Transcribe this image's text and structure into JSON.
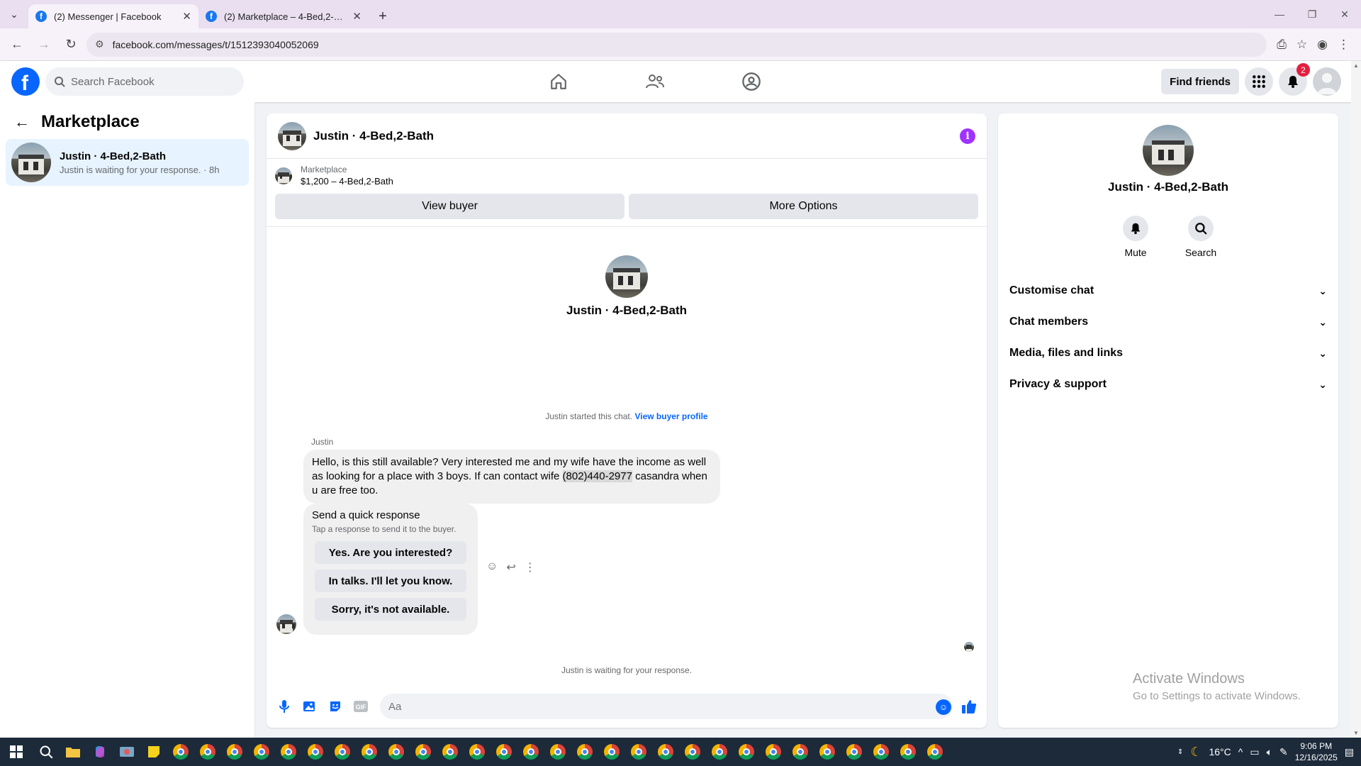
{
  "browser": {
    "tabs": [
      {
        "title": "(2) Messenger | Facebook",
        "active": true
      },
      {
        "title": "(2) Marketplace – 4-Bed,2-Bath",
        "active": false
      }
    ],
    "url": "facebook.com/messages/t/1512393040052069"
  },
  "fb_nav": {
    "search_placeholder": "Search Facebook",
    "find_friends": "Find friends",
    "notification_count": "2"
  },
  "left_panel": {
    "title": "Marketplace",
    "conversation": {
      "name": "Justin · 4-Bed,2-Bath",
      "preview": "Justin is waiting for your response. · 8h"
    }
  },
  "chat": {
    "title": "Justin · 4-Bed,2-Bath",
    "marketplace_label": "Marketplace",
    "listing": "$1,200 – 4-Bed,2-Bath",
    "view_buyer": "View buyer",
    "more_options": "More Options",
    "intro_name": "Justin · 4-Bed,2-Bath",
    "started_text": "Justin started this chat.",
    "view_buyer_profile": "View buyer profile",
    "sender": "Justin",
    "message_before_phone": "Hello, is this still available? Very interested me and my wife have the income as well as looking for a place with 3 boys. If can contact wife ",
    "message_phone": "(802)440-2977",
    "message_after_phone": " casandra when u are free too.",
    "quick_response_title": "Send a quick response",
    "quick_response_sub": "Tap a response to send it to the buyer.",
    "quick_responses": [
      "Yes. Are you interested?",
      "In talks. I'll let you know.",
      "Sorry, it's not available."
    ],
    "waiting": "Justin is waiting for your response.",
    "composer_placeholder": "Aa"
  },
  "right_panel": {
    "name": "Justin · 4-Bed,2-Bath",
    "mute": "Mute",
    "search": "Search",
    "sections": [
      "Customise chat",
      "Chat members",
      "Media, files and links",
      "Privacy & support"
    ],
    "activate_title": "Activate Windows",
    "activate_sub": "Go to Settings to activate Windows."
  },
  "taskbar": {
    "temperature": "16°C",
    "time": "9:06 PM",
    "date": "12/16/2025"
  },
  "colors": {
    "fb_blue": "#0866ff",
    "info_purple": "#a033ff",
    "badge_red": "#e41e3f",
    "selected_conv": "#e7f3ff"
  }
}
